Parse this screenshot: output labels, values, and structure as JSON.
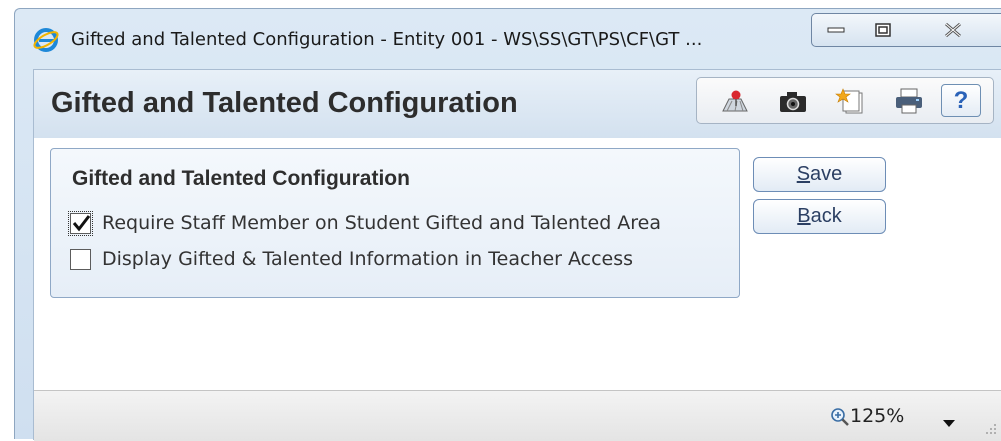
{
  "window": {
    "title": "Gifted and Talented Configuration - Entity 001 - WS\\SS\\GT\\PS\\CF\\GT ...",
    "icon": "ie-icon",
    "controls": [
      "minimize-icon",
      "maximize-icon",
      "close-icon"
    ]
  },
  "page": {
    "title": "Gifted and Talented Configuration"
  },
  "toolbar": {
    "icons": [
      "map-pin-icon",
      "camera-icon",
      "document-star-icon",
      "printer-icon"
    ],
    "help_label": "?"
  },
  "group": {
    "title": "Gifted and Talented Configuration",
    "options": [
      {
        "label": "Require Staff Member on Student Gifted and Talented Area",
        "checked": true
      },
      {
        "label": "Display Gifted & Talented Information in Teacher Access",
        "checked": false
      }
    ]
  },
  "actions": {
    "save_label": "Save",
    "back_label": "Back"
  },
  "status": {
    "zoom": "125%"
  },
  "colors": {
    "accent": "#2a62b8",
    "frame": "#cfdff0",
    "group_border": "#8fa8c6"
  }
}
